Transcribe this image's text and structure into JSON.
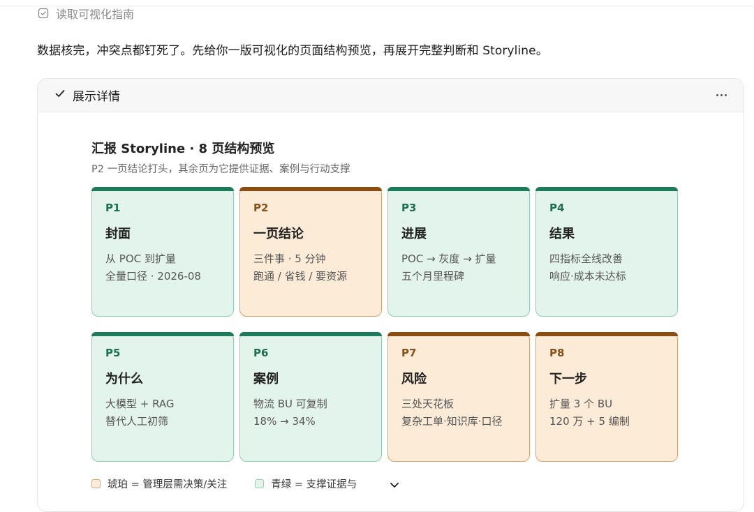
{
  "tool_call": {
    "label": "读取可视化指南",
    "icon": "check-square-icon"
  },
  "intro_text": "数据核完，冲突点都钉死了。先给你一版可视化的页面结构预览，再展开完整判断和 Storyline。",
  "panel": {
    "toggle_label": "展示详情",
    "toggle_icon": "checkmark-icon",
    "more_icon": "more-horizontal-icon"
  },
  "preview": {
    "title": "汇报 Storyline · 8 页结构预览",
    "subtitle": "P2 一页结论打头，其余页为它提供证据、案例与行动支撑",
    "cards": [
      {
        "num": "P1",
        "title": "封面",
        "line1": "从 POC 到扩量",
        "line2": "全量口径 · 2026-08",
        "tone": "teal"
      },
      {
        "num": "P2",
        "title": "一页结论",
        "line1": "三件事 · 5 分钟",
        "line2": "跑通 / 省钱 / 要资源",
        "tone": "amber"
      },
      {
        "num": "P3",
        "title": "进展",
        "line1": "POC → 灰度 → 扩量",
        "line2": "五个月里程碑",
        "tone": "teal"
      },
      {
        "num": "P4",
        "title": "结果",
        "line1": "四指标全线改善",
        "line2": "响应·成本未达标",
        "tone": "teal"
      },
      {
        "num": "P5",
        "title": "为什么",
        "line1": "大模型 + RAG",
        "line2": "替代人工初筛",
        "tone": "teal"
      },
      {
        "num": "P6",
        "title": "案例",
        "line1": "物流 BU 可复制",
        "line2": "18% → 34%",
        "tone": "teal"
      },
      {
        "num": "P7",
        "title": "风险",
        "line1": "三处天花板",
        "line2": "复杂工单·知识库·口径",
        "tone": "amber"
      },
      {
        "num": "P8",
        "title": "下一步",
        "line1": "扩量 3 个 BU",
        "line2": "120 万 + 5 编制",
        "tone": "amber"
      }
    ],
    "legend": [
      {
        "label": "琥珀 = 管理层需决策/关注",
        "tone": "amber"
      },
      {
        "label": "青绿 = 支撑证据与",
        "tone": "teal"
      }
    ]
  },
  "scroll_down_icon": "chevron-down-icon",
  "colors": {
    "teal_bar": "#1f7a5c",
    "teal_bg": "#e3f4ec",
    "amber_bar": "#8a4d12",
    "amber_bg": "#fcebd6"
  }
}
